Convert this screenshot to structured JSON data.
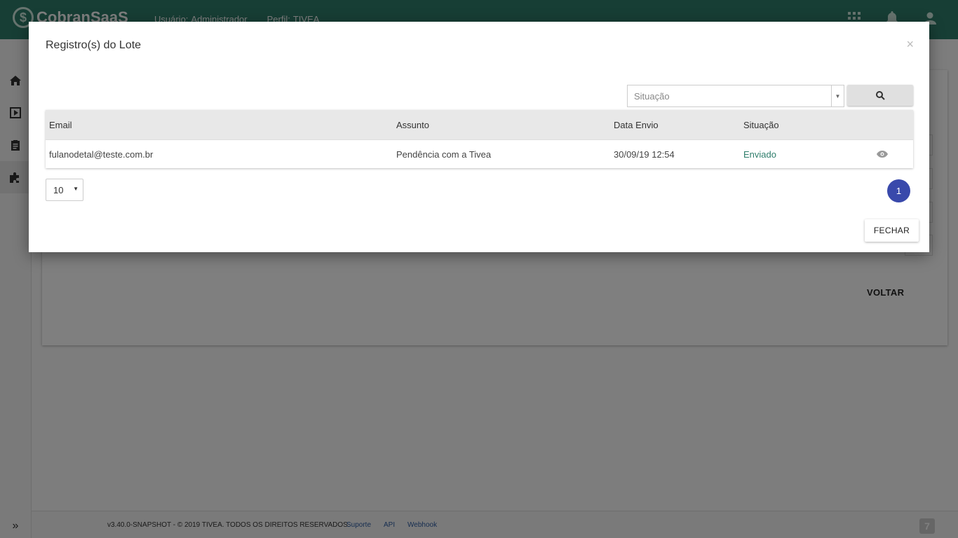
{
  "app": {
    "logo_text": "CobranSaaS",
    "user_label": "Usuário:",
    "user_value": "Administrador",
    "profile_label": "Perfil:",
    "profile_value": "TIVEA"
  },
  "topbar_icons": [
    "apps-grid-icon",
    "bell-icon",
    "user-icon"
  ],
  "sidebar": {
    "items": [
      "home-icon",
      "play-icon",
      "clipboard-icon",
      "puzzle-icon"
    ],
    "expand_label": "»"
  },
  "page": {
    "back_label": "VOLTAR"
  },
  "footer": {
    "version": "v3.40.0-SNAPSHOT - © 2019 TIVEA. TODOS OS DIREITOS RESERVADOS.",
    "links": [
      "Suporte",
      "API",
      "Webhook"
    ]
  },
  "modal": {
    "title": "Registro(s) do Lote",
    "close_label": "×",
    "filter": {
      "placeholder": "Situação",
      "value": ""
    },
    "columns": [
      "Email",
      "Assunto",
      "Data Envio",
      "Situação"
    ],
    "rows": [
      {
        "email": "fulanodetal@teste.com.br",
        "assunto": "Pendência com a Tivea",
        "data_envio": "30/09/19 12:54",
        "situacao": "Enviado"
      }
    ],
    "page_size": "10",
    "current_page": "1",
    "close_button_label": "FECHAR"
  },
  "colors": {
    "topbar": "#2e7d6b",
    "status_sent": "#2e7d6b",
    "page_active": "#3949ab"
  }
}
